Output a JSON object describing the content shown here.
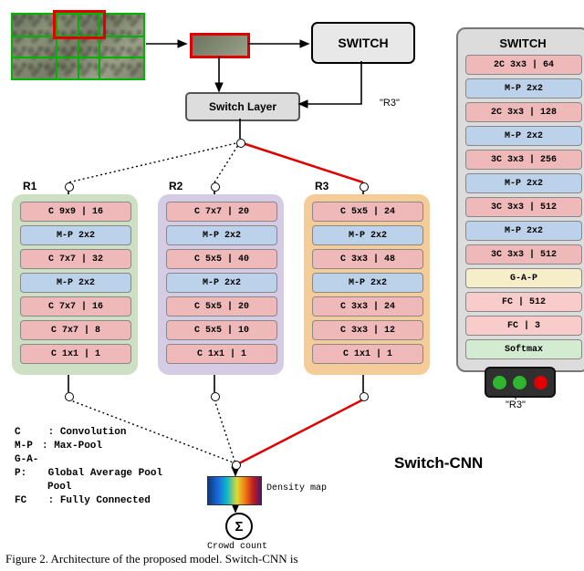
{
  "header": {
    "switch_box": "SWITCH",
    "switch_layer": "Switch Layer",
    "r3_caption": "\"R3\""
  },
  "columns": {
    "r1": {
      "label": "R1",
      "layers": [
        "C 9x9 | 16",
        "M-P 2x2",
        "C 7x7 | 32",
        "M-P 2x2",
        "C 7x7 | 16",
        "C 7x7 | 8",
        "C 1x1 | 1"
      ]
    },
    "r2": {
      "label": "R2",
      "layers": [
        "C 7x7 | 20",
        "M-P 2x2",
        "C 5x5 | 40",
        "M-P 2x2",
        "C 5x5 | 20",
        "C 5x5 | 10",
        "C 1x1 | 1"
      ]
    },
    "r3": {
      "label": "R3",
      "layers": [
        "C 5x5 | 24",
        "M-P 2x2",
        "C 3x3 | 48",
        "M-P 2x2",
        "C 3x3 | 24",
        "C 3x3 | 12",
        "C 1x1 | 1"
      ]
    }
  },
  "switch_detail": {
    "title": "SWITCH",
    "layers": [
      "2C 3x3 | 64",
      "M-P 2x2",
      "2C 3x3 | 128",
      "M-P 2x2",
      "3C 3x3 | 256",
      "M-P 2x2",
      "3C 3x3 | 512",
      "M-P 2x2",
      "3C 3x3 | 512",
      "G-A-P",
      "FC | 512",
      "FC | 3",
      "Softmax"
    ]
  },
  "legend": {
    "c": "Convolution",
    "mp": "Max-Pool",
    "gap": "Global Average Pool",
    "fc": "Fully Connected"
  },
  "brand": "Switch-CNN",
  "outputs": {
    "density_map": "Density map",
    "crowd_count": "Crowd count",
    "sigma": "Σ"
  },
  "r3_out": "\"R3\"",
  "caption": "Figure 2. Architecture of the proposed model. Switch-CNN is"
}
